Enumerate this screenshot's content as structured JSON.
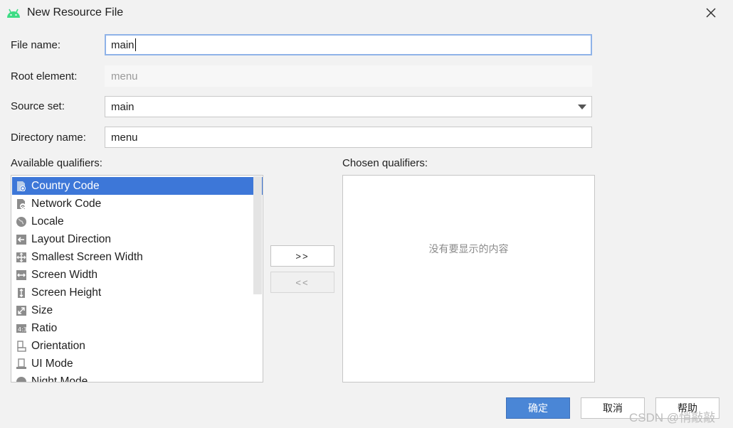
{
  "dialog": {
    "title": "New Resource File",
    "close_icon": "close-icon",
    "app_icon": "android-icon"
  },
  "form": {
    "file_name": {
      "label": "File name:",
      "value": "main"
    },
    "root_element": {
      "label": "Root element:",
      "placeholder": "menu"
    },
    "source_set": {
      "label": "Source set:",
      "value": "main"
    },
    "directory_name": {
      "label": "Directory name:",
      "value": "menu"
    }
  },
  "available": {
    "label": "Available qualifiers:",
    "selected_index": 0,
    "items": [
      {
        "label": "Country Code",
        "icon": "country-code-icon"
      },
      {
        "label": "Network Code",
        "icon": "network-code-icon"
      },
      {
        "label": "Locale",
        "icon": "globe-icon"
      },
      {
        "label": "Layout Direction",
        "icon": "layout-direction-icon"
      },
      {
        "label": "Smallest Screen Width",
        "icon": "smallest-width-icon"
      },
      {
        "label": "Screen Width",
        "icon": "screen-width-icon"
      },
      {
        "label": "Screen Height",
        "icon": "screen-height-icon"
      },
      {
        "label": "Size",
        "icon": "size-icon"
      },
      {
        "label": "Ratio",
        "icon": "ratio-icon"
      },
      {
        "label": "Orientation",
        "icon": "orientation-icon"
      },
      {
        "label": "UI Mode",
        "icon": "ui-mode-icon"
      },
      {
        "label": "Night Mode",
        "icon": "night-mode-icon"
      }
    ]
  },
  "chosen": {
    "label": "Chosen qualifiers:",
    "empty_text": "没有要显示的内容"
  },
  "move": {
    "add_label": ">>",
    "remove_label": "<<"
  },
  "buttons": {
    "ok": "确定",
    "cancel": "取消",
    "help": "帮助"
  },
  "watermark": "CSDN @悄敲敲",
  "colors": {
    "selection": "#3d77d8",
    "primary_button": "#4a86d6",
    "android_green": "#3ddc84"
  }
}
